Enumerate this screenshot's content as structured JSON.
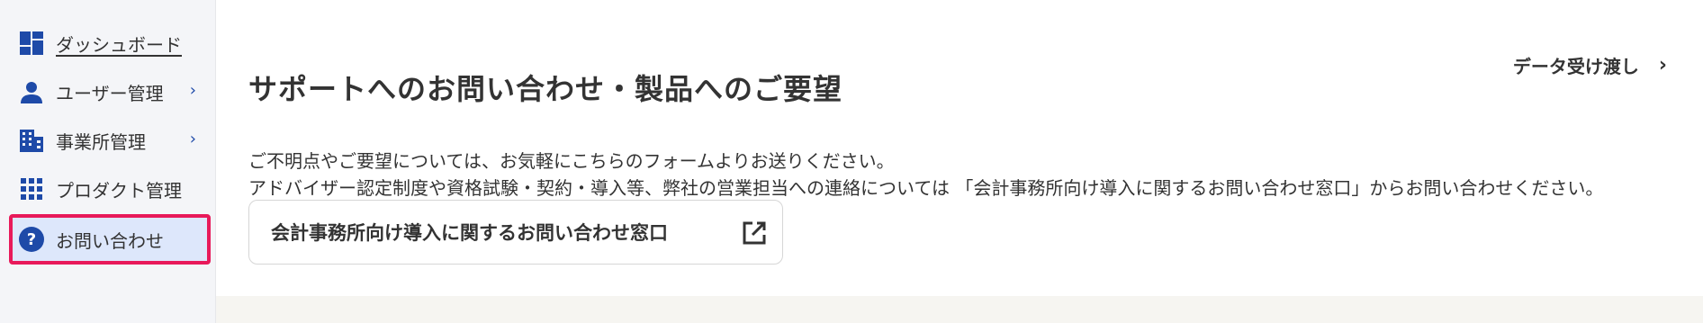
{
  "sidebar": {
    "items": [
      {
        "label": "ダッシュボード",
        "icon": "dashboard-icon"
      },
      {
        "label": "ユーザー管理",
        "icon": "person-icon",
        "chevron": "›"
      },
      {
        "label": "事業所管理",
        "icon": "building-icon",
        "chevron": "›"
      },
      {
        "label": "プロダクト管理",
        "icon": "apps-grid-icon"
      },
      {
        "label": "お問い合わせ",
        "icon": "help-circle-icon",
        "active": true
      }
    ]
  },
  "header": {
    "title": "サポートへのお問い合わせ・製品へのご要望",
    "top_link_label": "データ受け渡し",
    "top_link_chevron": "›"
  },
  "main": {
    "description_line1": "ご不明点やご要望については、お気軽にこちらのフォームよりお送りください。",
    "description_line2": "アドバイザー認定制度や資格試験・契約・導入等、弊社の営業担当への連絡については 「会計事務所向け導入に関するお問い合わせ窓口」からお問い合わせください。",
    "contact_button_label": "会計事務所向け導入に関するお問い合わせ窓口"
  },
  "colors": {
    "accent": "#1e4aa8",
    "active_border": "#e8195a",
    "active_bg": "#dde7fb",
    "sidebar_bg": "#f4f5f8",
    "footer_band": "#f6f5f1"
  }
}
